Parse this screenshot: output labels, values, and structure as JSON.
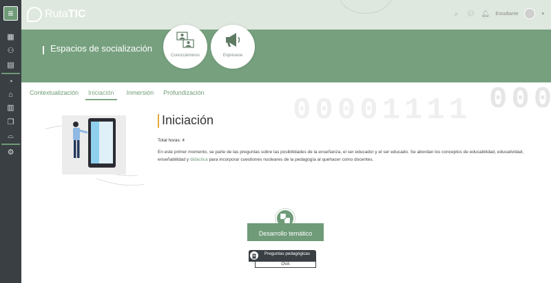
{
  "app": {
    "logo_part1": "Ruta",
    "logo_part2": "TIC"
  },
  "header": {
    "user_label": "Estudiante",
    "user_menu_caret": "▾"
  },
  "banner": {
    "title": "Espacios de socialización",
    "bubbles": [
      {
        "label": "Conozcámonos"
      },
      {
        "label": "Exprésese"
      }
    ]
  },
  "tabs": [
    {
      "label": "Contextualización",
      "active": false
    },
    {
      "label": "Iniciación",
      "active": true
    },
    {
      "label": "Inmersión",
      "active": false
    },
    {
      "label": "Profundización",
      "active": false
    }
  ],
  "content": {
    "title": "Iniciación",
    "hours": "Total horas: 4",
    "description_part1": "En este primer momento, se parte de las preguntas sobre las posibilidades de la enseñanza, el ser educador y el ser educado. Se abordan los conceptos de educabilidad, educatividad, enseñabilidad y ",
    "description_link": "didáctica",
    "description_part2": " para incorporar cuestiones nucleares de la pedagogía al quehacer como docentes."
  },
  "development": {
    "button_label": "Desarrollo temático"
  },
  "resource_card": {
    "title": "Preguntas pedagógicas",
    "type": "OVA"
  },
  "background": {
    "digits_main": "00001111",
    "digits_right": "000"
  },
  "colors": {
    "accent_green": "#6f9b78",
    "banner_green": "#76a07e",
    "rail_dark": "#3a3f44",
    "title_accent": "#e3a73a"
  }
}
